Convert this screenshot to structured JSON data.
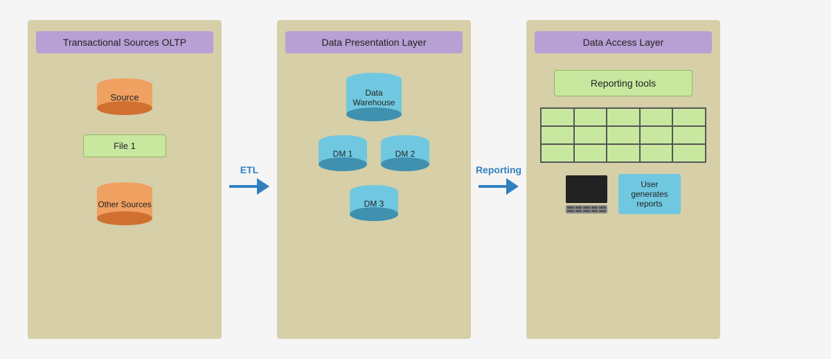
{
  "left_panel": {
    "title": "Transactional Sources OLTP",
    "source_label": "Source",
    "file_label": "File 1",
    "other_label": "Other Sources"
  },
  "middle_panel": {
    "title": "Data Presentation Layer",
    "warehouse_label": "Data\nWarehouse",
    "dm1_label": "DM 1",
    "dm2_label": "DM 2",
    "dm3_label": "DM 3"
  },
  "right_panel": {
    "title": "Data Access Layer",
    "reporting_tools_label": "Reporting tools",
    "user_reports_label": "User\ngenerates\nreports"
  },
  "arrows": {
    "etl_label": "ETL",
    "reporting_label": "Reporting"
  }
}
